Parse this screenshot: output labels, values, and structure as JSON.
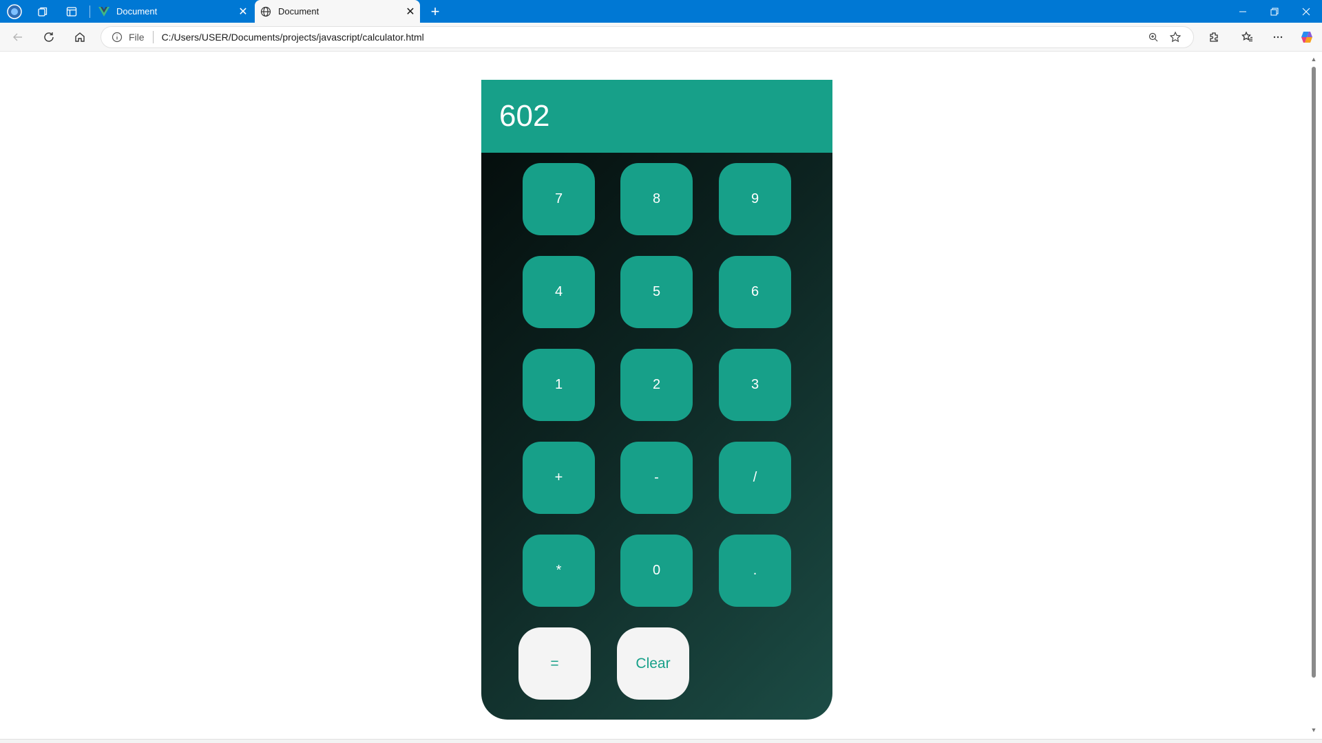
{
  "browser": {
    "tabs": [
      {
        "title": "Document",
        "state": "inactive",
        "favicon": "vue-logo-icon"
      },
      {
        "title": "Document",
        "state": "active",
        "favicon": "globe-icon"
      }
    ],
    "address": {
      "scheme_label": "File",
      "url": "C:/Users/USER/Documents/projects/javascript/calculator.html"
    },
    "accent_color": "#0078d4"
  },
  "calculator": {
    "display": "602",
    "keys": [
      "7",
      "8",
      "9",
      "4",
      "5",
      "6",
      "1",
      "2",
      "3",
      "+",
      "-",
      "/",
      "*",
      "0",
      "."
    ],
    "equals_label": "=",
    "clear_label": "Clear",
    "colors": {
      "key": "#17a089",
      "display": "#17a089",
      "action_key": "#f4f4f4",
      "body_dark": "#030a09",
      "body_light": "#1c4c45"
    }
  }
}
